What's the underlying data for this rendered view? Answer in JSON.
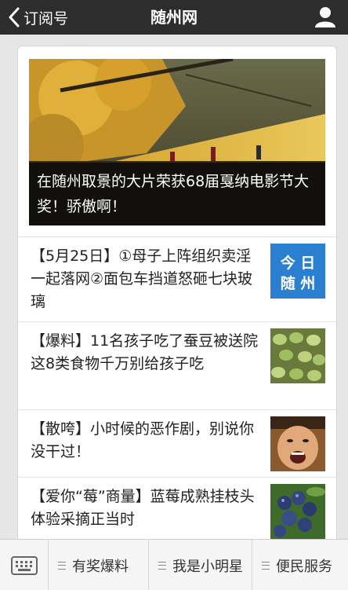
{
  "header": {
    "back_label": "订阅号",
    "title": "随州网",
    "icons": {
      "back": "chevron-left-icon",
      "user": "user-icon"
    }
  },
  "hero": {
    "caption": "在随州取景的大片荣获68届戛纳电影节大奖！骄傲啊！"
  },
  "articles": [
    {
      "title": "【5月25日】①母子上阵组织卖淫一起落网②面包车挡道怒砸七块玻璃",
      "thumb_text": [
        "今 日",
        "随 州"
      ],
      "thumb_color": "#2b7fd0"
    },
    {
      "title": "【爆料】11名孩子吃了蚕豆被送院 这8类食物千万别给孩子吃"
    },
    {
      "title": "【散咵】小时候的恶作剧，别说你没干过！"
    },
    {
      "title": "【爱你“莓”商量】蓝莓成熟挂枝头 体验采摘正当时"
    }
  ],
  "bottom_menu": {
    "keyboard_icon": "keyboard-icon",
    "items": [
      "有奖爆料",
      "我是小明星",
      "便民服务"
    ]
  }
}
